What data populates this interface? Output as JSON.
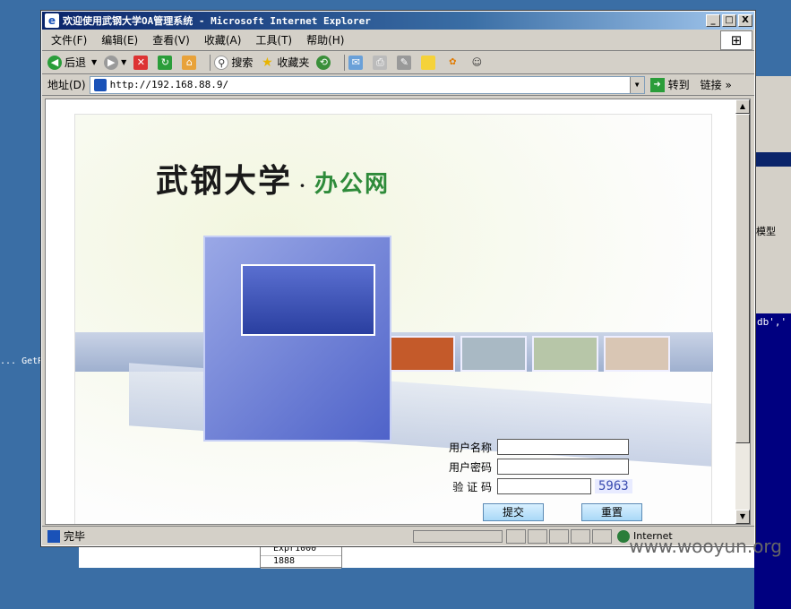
{
  "window": {
    "title": "欢迎使用武钢大学OA管理系统 - Microsoft Internet Explorer",
    "buttons": {
      "minimize": "_",
      "maximize": "□",
      "close": "X"
    }
  },
  "menu": [
    "文件(F)",
    "编辑(E)",
    "查看(V)",
    "收藏(A)",
    "工具(T)",
    "帮助(H)"
  ],
  "toolbar": {
    "back": "后退",
    "search": "搜索",
    "favorites": "收藏夹"
  },
  "address": {
    "label": "地址(D)",
    "url": "http://192.168.88.9/",
    "go": "转到",
    "links": "链接"
  },
  "page": {
    "brand_main": "武钢大学",
    "brand_sep": "·",
    "brand_sub": "办公网",
    "username_label": "用户名称",
    "password_label": "用户密码",
    "captcha_label": "验 证 码",
    "captcha_code": "5963",
    "submit": "提交",
    "reset": "重置"
  },
  "status": {
    "text": "完毕",
    "zone": "Internet"
  },
  "background": {
    "left_text": "... GetR",
    "model_label": "模型",
    "code": "db','",
    "grid_rows": [
      "Expr1000",
      "1888"
    ],
    "watermark": "www.wooyun.org"
  },
  "colors": {
    "title_bar": "#0a246a",
    "brand_sub": "#2e8b3a",
    "desktop": "#3a6ea5"
  }
}
